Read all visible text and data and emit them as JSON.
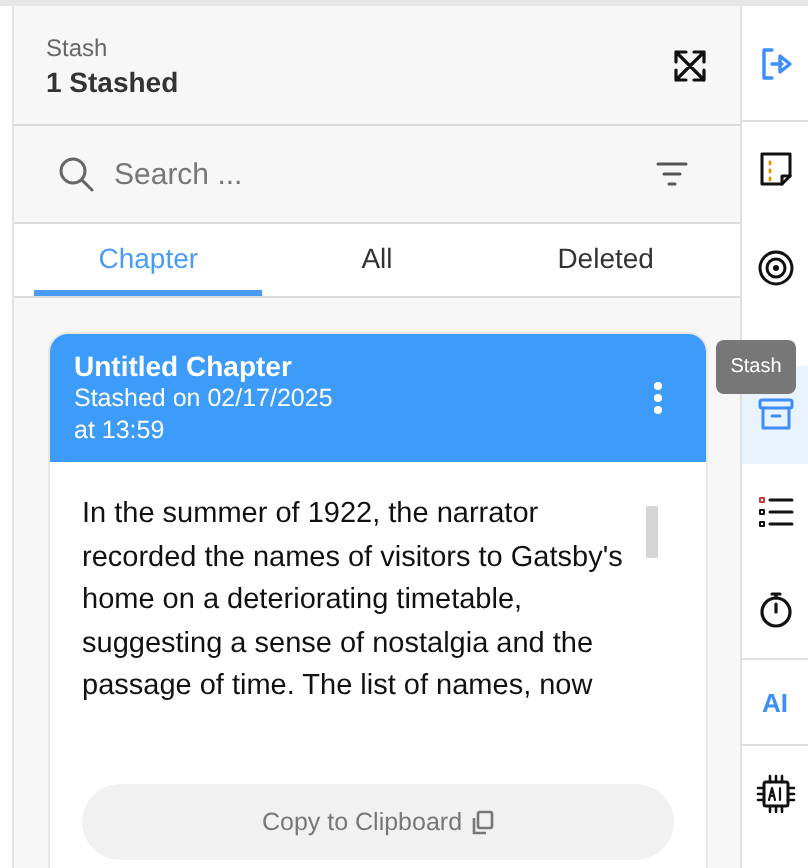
{
  "header": {
    "title": "Stash",
    "count": "1 Stashed"
  },
  "search": {
    "placeholder": "Search ..."
  },
  "tabs": [
    {
      "label": "Chapter",
      "selected": true
    },
    {
      "label": "All",
      "selected": false
    },
    {
      "label": "Deleted",
      "selected": false
    }
  ],
  "cards": [
    {
      "title": "Untitled Chapter",
      "stamp": "Stashed on 02/17/2025\nat 13:59",
      "body": "In the summer of 1922, the narrator recorded the names of visitors to Gatsby's home on a deteriorating timetable, suggesting a sense of nostalgia and the passage of time. The list of names, now",
      "button": "Copy to Clipboard"
    }
  ],
  "rail": [
    {
      "kind": "icon",
      "selected": false
    },
    {
      "kind": "icon",
      "selected": false
    },
    {
      "kind": "icon",
      "selected": false
    },
    {
      "kind": "icon",
      "selected": true
    },
    {
      "kind": "icon",
      "selected": false
    },
    {
      "kind": "icon",
      "selected": false
    },
    {
      "kind": "text",
      "label": "AI",
      "selected": false
    },
    {
      "kind": "icon",
      "selected": false
    }
  ],
  "tooltip": "Stash"
}
